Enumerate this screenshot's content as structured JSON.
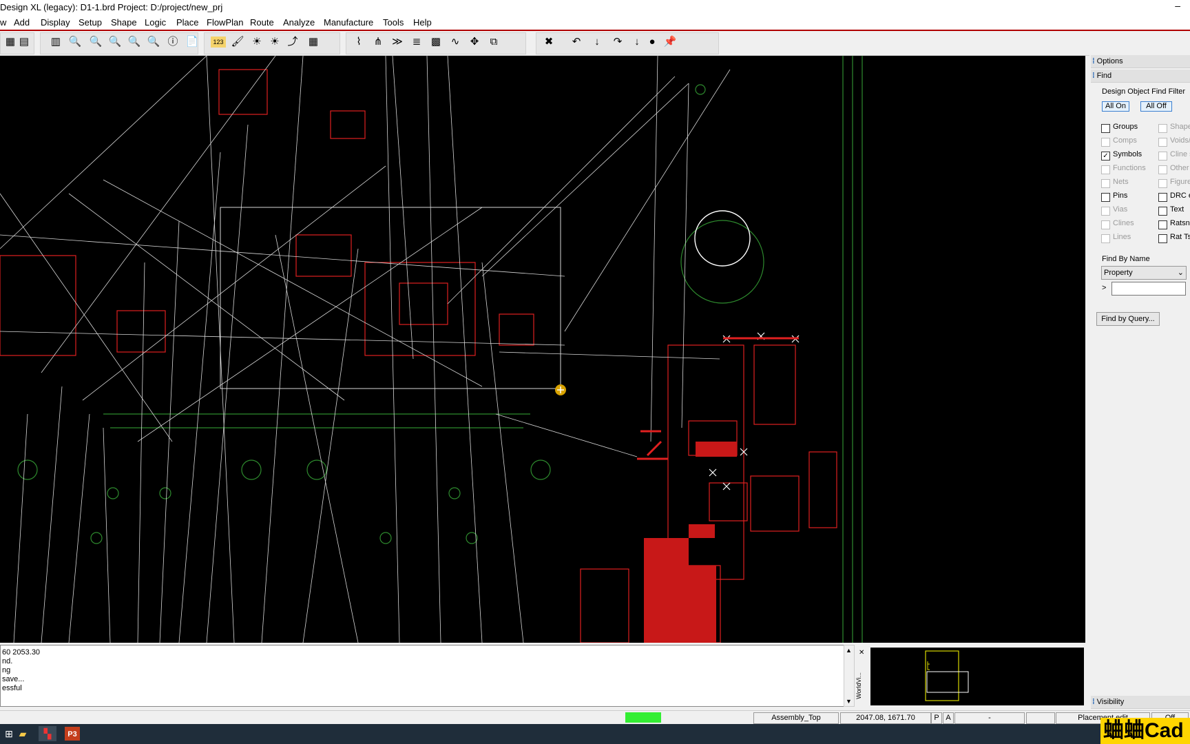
{
  "window": {
    "title": "Design XL (legacy): D1-1.brd  Project: D:/project/new_prj",
    "minimize": "–"
  },
  "menu": [
    "w",
    "Add",
    "Display",
    "Setup",
    "Shape",
    "Logic",
    "Place",
    "FlowPlan",
    "Route",
    "Analyze",
    "Manufacture",
    "Tools",
    "Help"
  ],
  "toolbar": {
    "icons": [
      "layers-icon",
      "grid-icon",
      "grid2-icon",
      "zoom-fit-icon",
      "zoom-in-icon",
      "zoom-in2-icon",
      "zoom-out-icon",
      "zoom-prev-icon",
      "info-icon",
      "report-icon",
      "counter-icon",
      "highlight-icon",
      "sun-icon",
      "sun2-icon",
      "add-connect-icon",
      "slide-icon",
      "delay-tune-icon",
      "fanout-icon",
      "bundle-icon",
      "stack-icon",
      "matrix-icon",
      "wave-icon",
      "move-icon",
      "copy-icon",
      "delete-icon",
      "undo-icon",
      "down-icon",
      "redo-icon",
      "down2-icon",
      "globe-icon",
      "pin-icon"
    ],
    "glyphs": [
      "▦",
      "▤",
      "▥",
      "🔍",
      "🔍",
      "🔍",
      "🔍",
      "🔍",
      "ⓘ",
      "📄",
      "123",
      "🖌",
      "☀",
      "☀",
      "⤴",
      "▦",
      "⌇",
      "⋔",
      "≫",
      "≣",
      "▩",
      "∿",
      "✥",
      "⧉",
      "✖",
      "↶",
      "↓",
      "↷",
      "↓",
      "●",
      "📌"
    ],
    "counter_text": "123"
  },
  "find_panel": {
    "options_header": "Options",
    "find_header": "Find",
    "filter_title": "Design Object Find Filter",
    "all_on": "All On",
    "all_off": "All Off",
    "left_items": [
      {
        "label": "Groups",
        "checked": false,
        "enabled": true
      },
      {
        "label": "Comps",
        "checked": false,
        "enabled": false
      },
      {
        "label": "Symbols",
        "checked": true,
        "enabled": true
      },
      {
        "label": "Functions",
        "checked": false,
        "enabled": false
      },
      {
        "label": "Nets",
        "checked": false,
        "enabled": false
      },
      {
        "label": "Pins",
        "checked": false,
        "enabled": true
      },
      {
        "label": "Vias",
        "checked": false,
        "enabled": false
      },
      {
        "label": "Clines",
        "checked": false,
        "enabled": false
      },
      {
        "label": "Lines",
        "checked": false,
        "enabled": false
      }
    ],
    "right_items": [
      {
        "label": "Shapes",
        "checked": false,
        "enabled": false
      },
      {
        "label": "Voids/",
        "checked": false,
        "enabled": false
      },
      {
        "label": "Cline s",
        "checked": false,
        "enabled": false
      },
      {
        "label": "Other",
        "checked": false,
        "enabled": false
      },
      {
        "label": "Figure",
        "checked": false,
        "enabled": false
      },
      {
        "label": "DRC e",
        "checked": false,
        "enabled": true
      },
      {
        "label": "Text",
        "checked": false,
        "enabled": true
      },
      {
        "label": "Ratsne",
        "checked": false,
        "enabled": true
      },
      {
        "label": "Rat Ts",
        "checked": false,
        "enabled": true
      }
    ],
    "find_by_name_title": "Find By Name",
    "find_by_name_type": "Property",
    "name_prefix": ">",
    "name_value": "",
    "find_by_query": "Find by Query...",
    "visibility_header": "Visibility"
  },
  "console": {
    "lines": [
      "60 2053.30",
      "nd.",
      "ng",
      "save...",
      "essful"
    ]
  },
  "worldview_label": "WorldVi...",
  "status": {
    "layer": "Assembly_Top",
    "coords": "2047.08, 1671.70",
    "p_flag": "P",
    "a_flag": "A",
    "dash": "-",
    "mode": "Placement edit",
    "off": "Off",
    "indicator_color": "#33ee33"
  },
  "taskbar": {
    "icons": [
      "windows-icon",
      "file-explorer-icon",
      "allegro-app-icon",
      "powerpoint-icon"
    ],
    "powerpoint_label": "P3"
  },
  "watermark": "蛐蛐Cad",
  "colors": {
    "board_bg": "#000000",
    "pad_red": "#e02020",
    "ratsnest": "#d8d8d8",
    "outline_green": "#2e8b2e"
  }
}
